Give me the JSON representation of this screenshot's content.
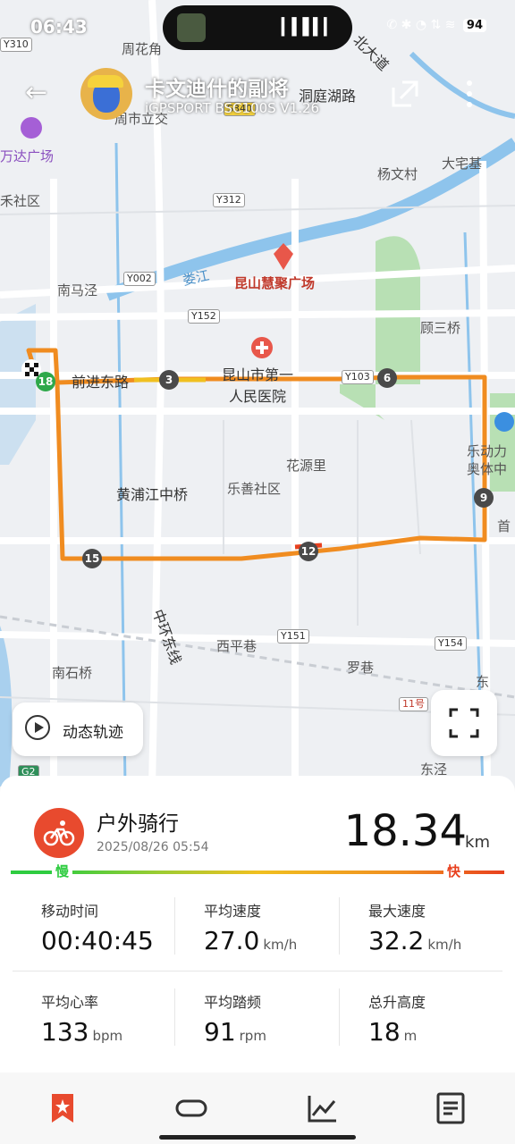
{
  "status_bar": {
    "time": "06:43",
    "battery": "94",
    "system_icons_text": "✆ ✱ ◔ ⇅ ≋"
  },
  "header": {
    "user_name": "卡文迪什的副将",
    "device": "iGPSPORT BSC100S  V1.26",
    "back_icon": "back-arrow-icon",
    "share_icon": "share-icon",
    "more_icon": "more-vertical-icon"
  },
  "map": {
    "labels": [
      "周花角",
      "周市立交",
      "北大道",
      "洞庭湖路",
      "万达广场",
      "杨文村",
      "大宅基",
      "禾社区",
      "南马泾",
      "昆山慧聚广场",
      "娄江",
      "顾三桥",
      "前进东路",
      "昆山市第一",
      "人民医院",
      "花源里",
      "乐善社区",
      "黄浦江中桥",
      "乐动力",
      "奥体中",
      "首",
      "中环东线",
      "西平巷",
      "罗巷",
      "南石桥",
      "东泾",
      "东"
    ],
    "road_tags": [
      "Y310",
      "S340",
      "Y312",
      "Y002",
      "Y152",
      "Y103",
      "Y151",
      "Y154",
      "11号",
      "G2"
    ],
    "km_markers": [
      "18",
      "3",
      "6",
      "9",
      "12",
      "15"
    ],
    "dynamic_track_label": "动态轨迹"
  },
  "summary": {
    "sport": "户外骑行",
    "date": "2025/08/26 05:54",
    "distance": "18.34",
    "distance_unit": "km",
    "legend_slow": "慢",
    "legend_fast": "快",
    "accent_color": "#e84a2e"
  },
  "stats": [
    {
      "label": "移动时间",
      "value": "00:40:45",
      "unit": ""
    },
    {
      "label": "平均速度",
      "value": "27.0",
      "unit": "km/h"
    },
    {
      "label": "最大速度",
      "value": "32.2",
      "unit": "km/h"
    },
    {
      "label": "平均心率",
      "value": "133",
      "unit": "bpm"
    },
    {
      "label": "平均踏频",
      "value": "91",
      "unit": "rpm"
    },
    {
      "label": "总升高度",
      "value": "18",
      "unit": "m"
    }
  ],
  "tabs": [
    "bookmark-icon",
    "loop-icon",
    "chart-icon",
    "document-icon"
  ]
}
